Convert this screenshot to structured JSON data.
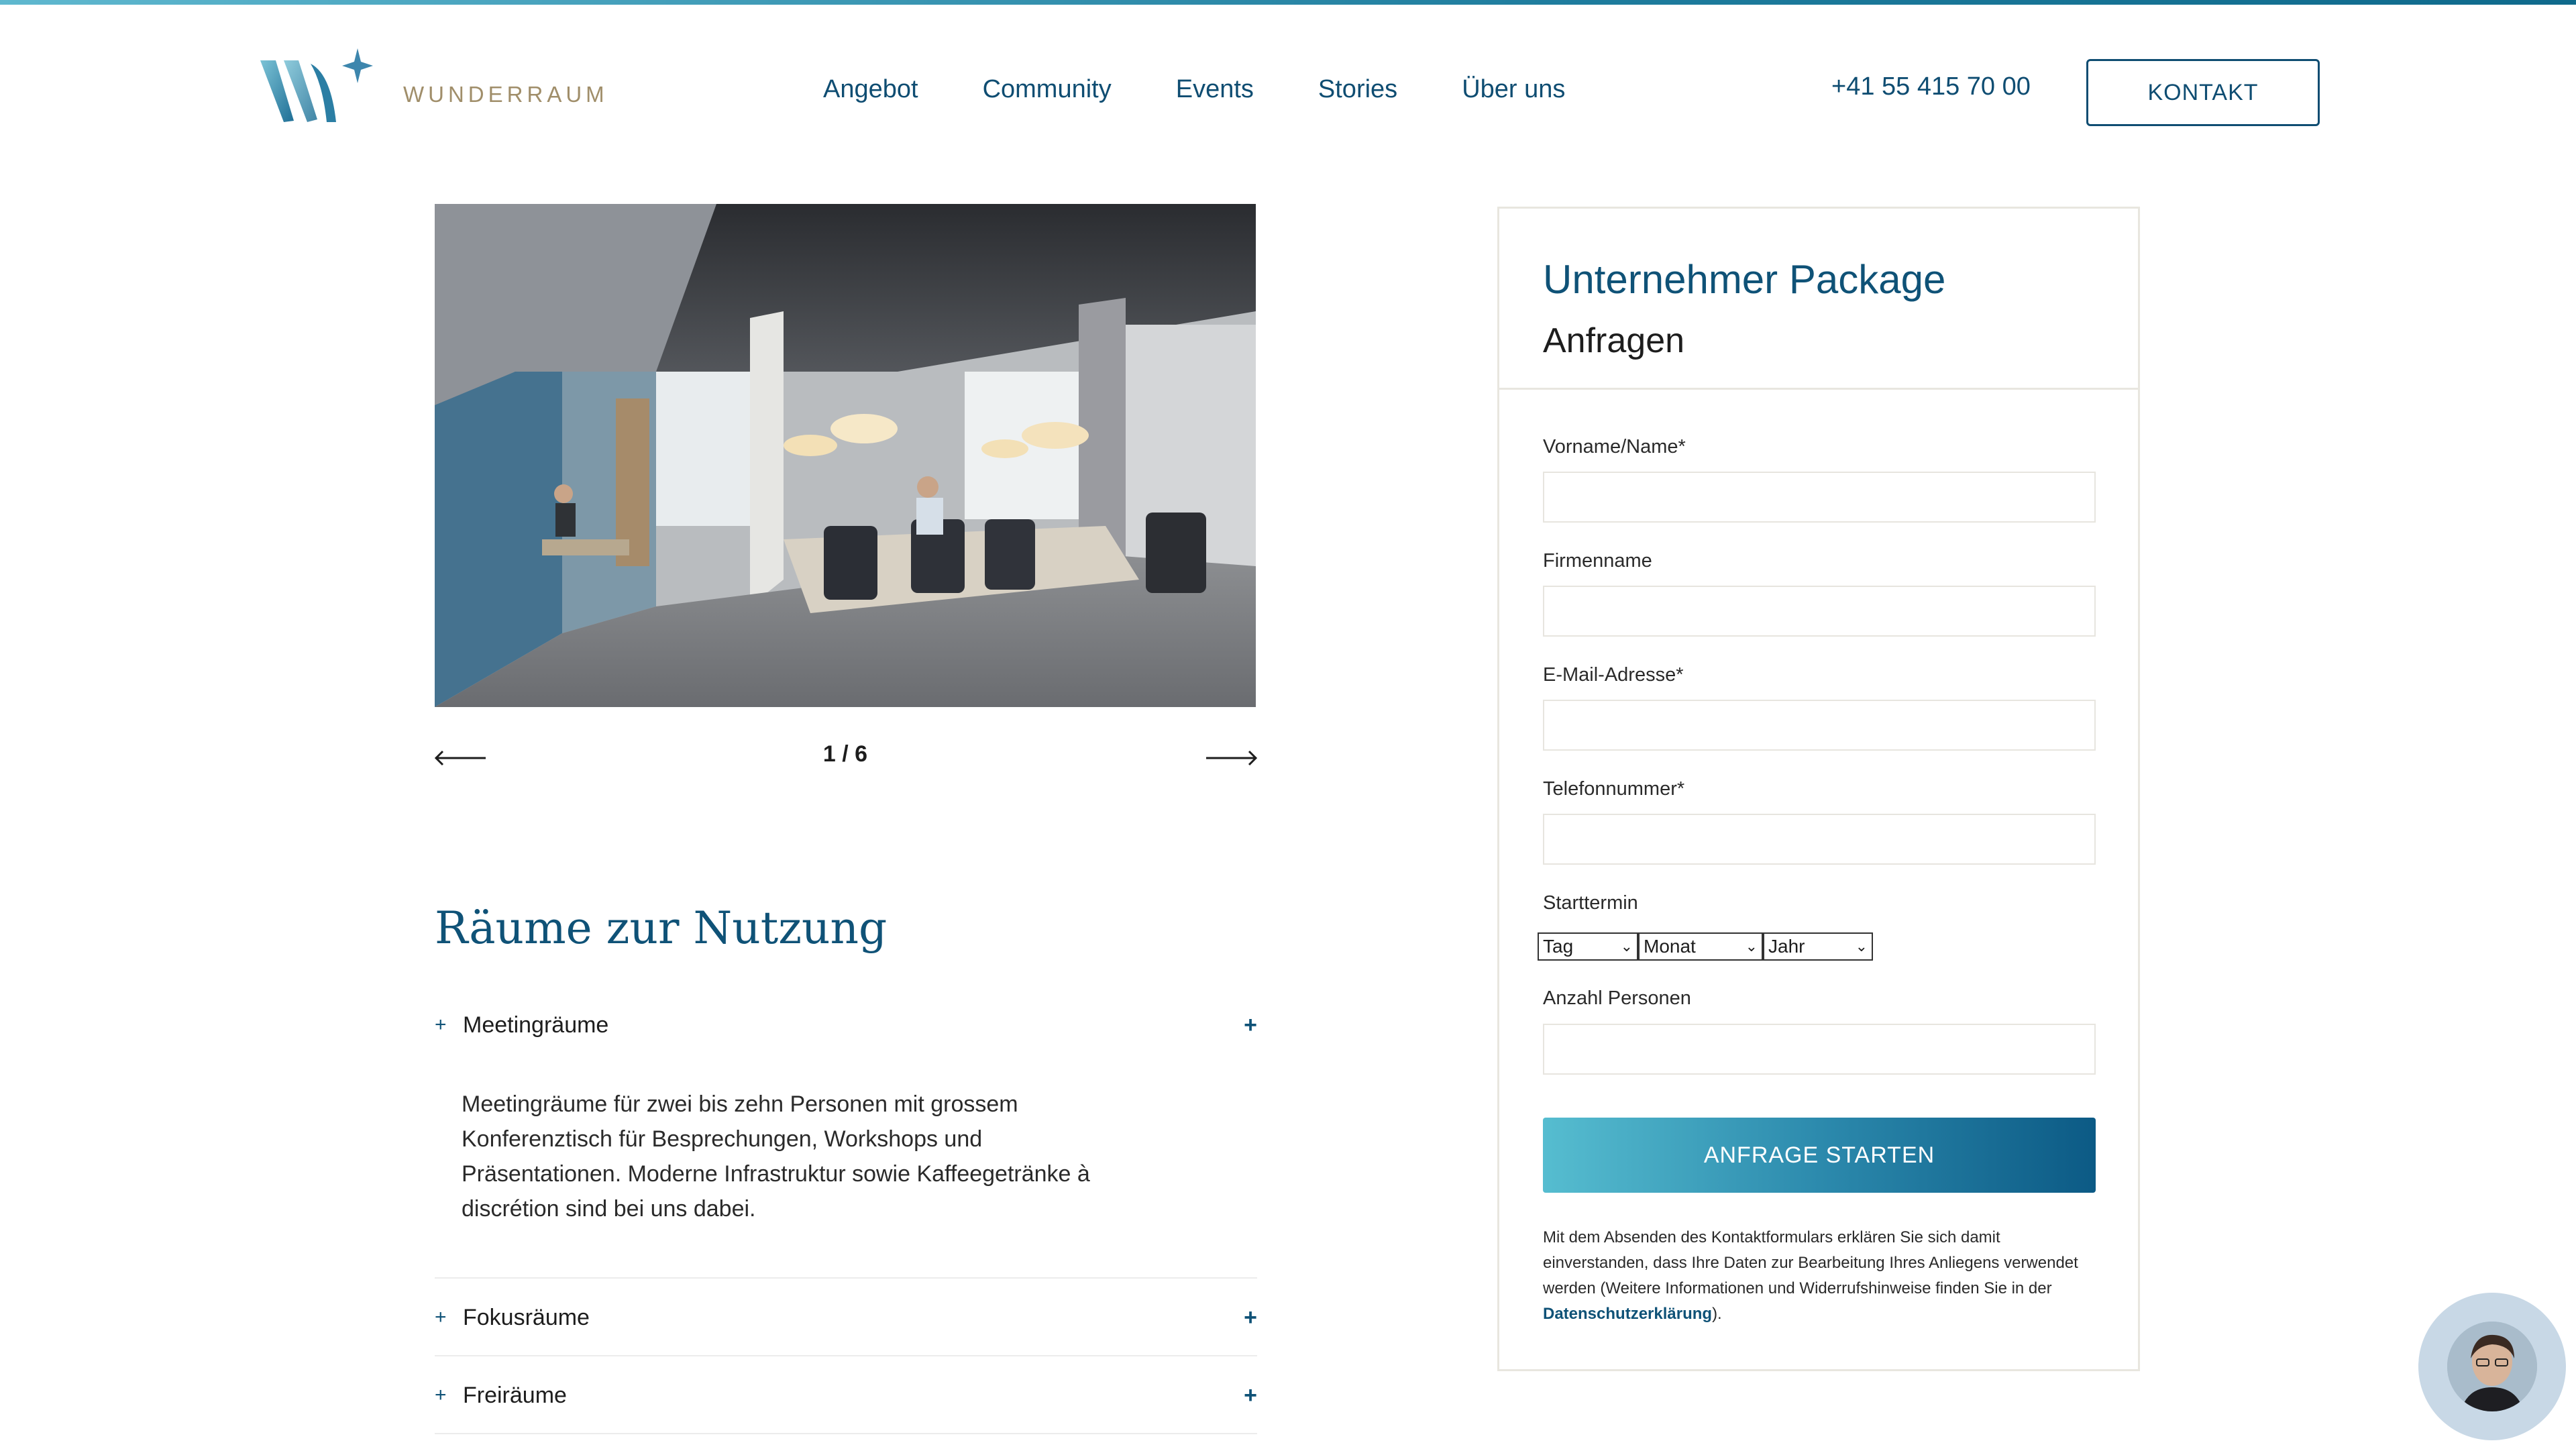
{
  "header": {
    "logo_text": "WUNDERRAUM",
    "nav": [
      "Angebot",
      "Community",
      "Events",
      "Stories",
      "Über uns"
    ],
    "phone": "+41 55 415 70 00",
    "contact_button": "KONTAKT"
  },
  "gallery": {
    "counter": "1 / 6"
  },
  "rooms": {
    "title": "Räume zur Nutzung",
    "items": [
      {
        "label": "Meetingräume",
        "expanded": true,
        "description": "Meetingräume für zwei bis zehn Personen mit grossem Konferenztisch für Besprechungen, Workshops und Präsentationen. Moderne Infrastruktur sowie Kaffeegetränke à discrétion sind bei uns dabei."
      },
      {
        "label": "Fokusräume",
        "expanded": false
      },
      {
        "label": "Freiräume",
        "expanded": false
      }
    ]
  },
  "form": {
    "title": "Unternehmer Package",
    "subtitle": "Anfragen",
    "fields": {
      "name": "Vorname/Name*",
      "company": "Firmenname",
      "email": "E-Mail-Adresse*",
      "phone": "Telefonnummer*",
      "start": "Starttermin",
      "persons": "Anzahl Personen"
    },
    "date_selects": {
      "day": "Tag",
      "month": "Monat",
      "year": "Jahr"
    },
    "submit": "ANFRAGE STARTEN",
    "consent_text": "Mit dem Absenden des Kontaktformulars erklären Sie sich damit einverstanden, dass Ihre Daten zur Bearbeitung Ihres Anliegens verwendet werden (Weitere Informationen und Widerrufshinweise finden Sie in der ",
    "consent_link": "Datenschutzerklärung",
    "consent_end": ")."
  },
  "colors": {
    "brand": "#0f5277",
    "accent_gold": "#a08e6a",
    "button_gradient_start": "#56bdd0",
    "button_gradient_end": "#0c5a85"
  }
}
